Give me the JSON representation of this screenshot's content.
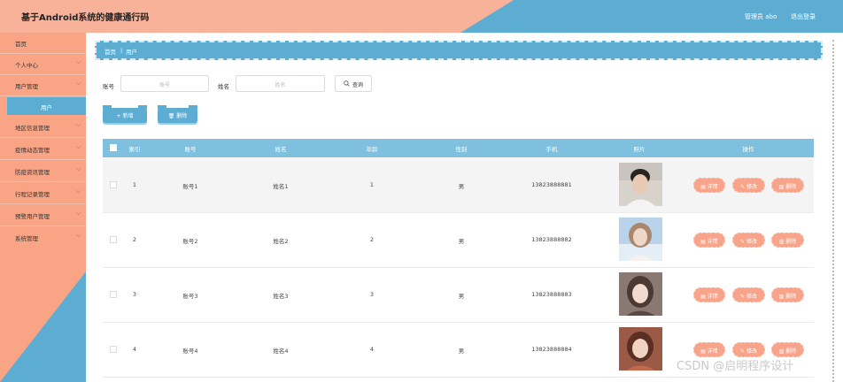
{
  "header": {
    "title": "基于Android系统的健康通行码",
    "admin_label": "管理员 abo",
    "logout_label": "退出登录"
  },
  "sidebar": {
    "items": [
      {
        "label": "首页",
        "has_chevron": false
      },
      {
        "label": "个人中心",
        "has_chevron": true
      },
      {
        "label": "用户管理",
        "has_chevron": true
      },
      {
        "label": "地区信息管理",
        "has_chevron": true
      },
      {
        "label": "疫情动态管理",
        "has_chevron": true
      },
      {
        "label": "防疫资讯管理",
        "has_chevron": true
      },
      {
        "label": "行程记录管理",
        "has_chevron": true
      },
      {
        "label": "预警用户管理",
        "has_chevron": true
      },
      {
        "label": "系统管理",
        "has_chevron": true
      }
    ],
    "active_sub": "用户"
  },
  "breadcrumb": {
    "home": "首页",
    "current": "用户"
  },
  "search": {
    "account_label": "账号",
    "account_placeholder": "账号",
    "name_label": "姓名",
    "name_placeholder": "姓名",
    "query_label": "查询"
  },
  "actions": {
    "add_label": "+ 新增",
    "delete_label": "删除"
  },
  "table": {
    "columns": [
      "索引",
      "账号",
      "姓名",
      "年龄",
      "性别",
      "手机",
      "照片",
      "操作"
    ],
    "rows": [
      {
        "index": "1",
        "account": "账号1",
        "name": "姓名1",
        "age": "1",
        "gender": "男",
        "phone": "13823888881"
      },
      {
        "index": "2",
        "account": "账号2",
        "name": "姓名2",
        "age": "2",
        "gender": "男",
        "phone": "13823888882"
      },
      {
        "index": "3",
        "account": "账号3",
        "name": "姓名3",
        "age": "3",
        "gender": "男",
        "phone": "13823888883"
      },
      {
        "index": "4",
        "account": "账号4",
        "name": "姓名4",
        "age": "4",
        "gender": "男",
        "phone": "13823888884"
      }
    ],
    "op_labels": {
      "detail": "详情",
      "edit": "修改",
      "delete": "删除"
    }
  },
  "watermark": "CSDN @启明程序设计",
  "colors": {
    "salmon": "#f9a585",
    "blue": "#5dadd3",
    "header_blue": "#7fc0df",
    "op_button": "#f7a48a"
  }
}
